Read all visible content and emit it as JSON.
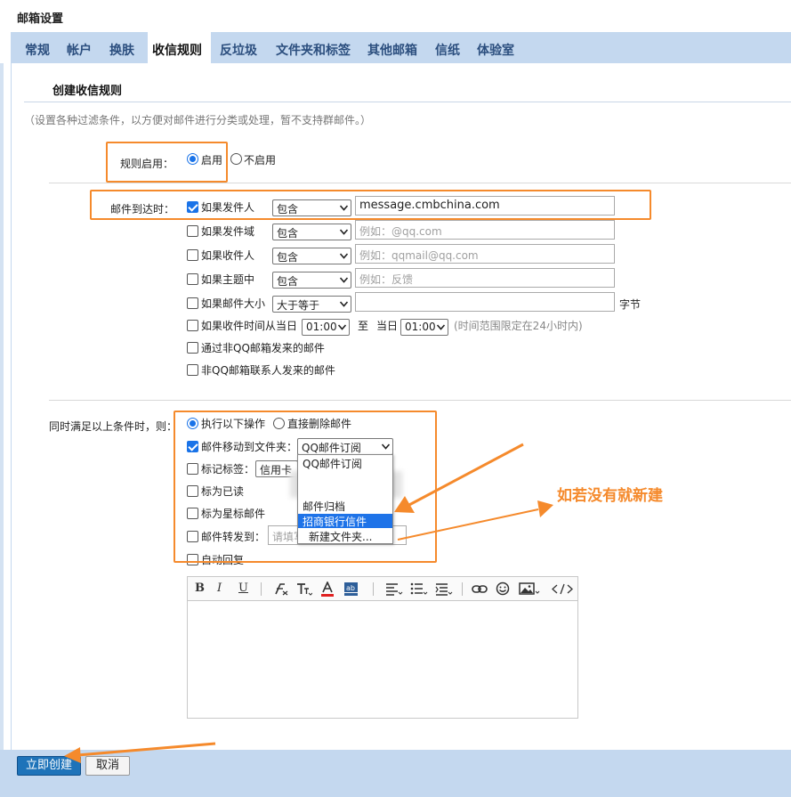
{
  "page": {
    "title": "邮箱设置"
  },
  "tabs": [
    "常规",
    "帐户",
    "换肤",
    "收信规则",
    "反垃圾",
    "文件夹和标签",
    "其他邮箱",
    "信纸",
    "体验室"
  ],
  "active_tab": "收信规则",
  "section": {
    "title": "创建收信规则",
    "hint": "（设置各种过滤条件，以方便对邮件进行分类或处理，暂不支持群邮件。）"
  },
  "rule_enable": {
    "label": "规则启用：",
    "on": "启用",
    "off": "不启用"
  },
  "conditions": {
    "label": "邮件到达时：",
    "sender": {
      "label": "如果发件人",
      "op": "包含",
      "value": "message.cmbchina.com"
    },
    "sender_domain": {
      "label": "如果发件域",
      "op": "包含",
      "placeholder": "例如：@qq.com"
    },
    "recipient": {
      "label": "如果收件人",
      "op": "包含",
      "placeholder": "例如：qqmail@qq.com"
    },
    "subject": {
      "label": "如果主题中",
      "op": "包含",
      "placeholder": "例如：反馈"
    },
    "size": {
      "label": "如果邮件大小",
      "op": "大于等于",
      "unit": "字节"
    },
    "time": {
      "label": "如果收件时间从当日",
      "from": "01:00",
      "to_label": "至",
      "day_label": "当日",
      "to": "01:00",
      "note": "(时间范围限定在24小时内)"
    },
    "non_qq": "通过非QQ邮箱发来的邮件",
    "non_contact": "非QQ邮箱联系人发来的邮件"
  },
  "actions": {
    "label": "同时满足以上条件时，则：",
    "execute": "执行以下操作",
    "delete": "直接删除邮件",
    "move": {
      "label": "邮件移动到文件夹：",
      "value": "QQ邮件订阅"
    },
    "tag": {
      "label": "标记标签：",
      "value": "信用卡"
    },
    "read": "标为已读",
    "star": "标为星标邮件",
    "forward": {
      "label": "邮件转发到：",
      "placeholder": "请填写"
    },
    "auto_reply": "自动回复"
  },
  "folder_dropdown": {
    "items": [
      "QQ邮件订阅",
      "邮件归档",
      "招商银行信件",
      "新建文件夹..."
    ],
    "selected": "招商银行信件"
  },
  "toolbar": [
    "B",
    "I",
    "U"
  ],
  "annotation": "如若没有就新建",
  "footer": {
    "create": "立即创建",
    "cancel": "取消"
  },
  "colors": {
    "accent": "#1a73e8",
    "annotation": "#f58a2c",
    "tab_bar": "#c4d8ef",
    "primary_button": "#1e73b9"
  }
}
